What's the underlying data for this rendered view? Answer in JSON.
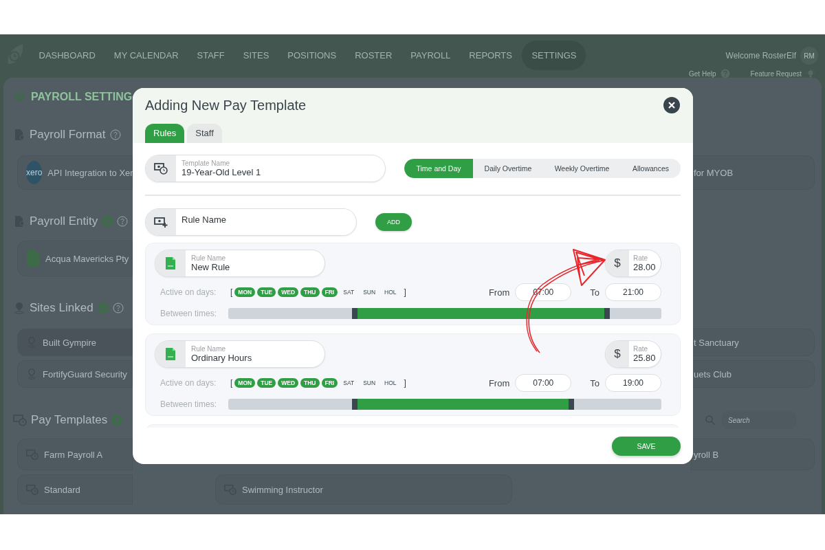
{
  "nav": {
    "items": [
      {
        "label": "DASHBOARD",
        "selected": false
      },
      {
        "label": "MY CALENDAR",
        "selected": false
      },
      {
        "label": "STAFF",
        "selected": false
      },
      {
        "label": "SITES",
        "selected": false
      },
      {
        "label": "POSITIONS",
        "selected": false
      },
      {
        "label": "ROSTER",
        "selected": false
      },
      {
        "label": "PAYROLL",
        "selected": false
      },
      {
        "label": "REPORTS",
        "selected": false
      },
      {
        "label": "SETTINGS",
        "selected": true
      }
    ],
    "welcome": "Welcome RosterElf",
    "avatar": "RM",
    "help": "Get Help",
    "feature": "Feature Request"
  },
  "background": {
    "title": "PAYROLL SETTING",
    "payroll_format": {
      "title": "Payroll Format",
      "items": [
        {
          "logo": "xero",
          "label": "API Integration to Xer"
        },
        {
          "label": "for MYOB"
        }
      ]
    },
    "payroll_entity": {
      "title": "Payroll Entity",
      "can_add": true,
      "items": [
        {
          "label": "Acqua Mavericks Pty"
        }
      ]
    },
    "sites_linked": {
      "title": "Sites Linked",
      "can_add": true,
      "items": [
        {
          "label": "Built Gympire"
        },
        {
          "label": "FortifyGuard Security"
        },
        {
          "label": "t Sanctuary"
        },
        {
          "label": "uets Club"
        }
      ]
    },
    "pay_templates": {
      "title": "Pay Templates",
      "can_add": true,
      "search_placeholder": "Search",
      "items": [
        {
          "label": "Farm Payroll A"
        },
        {
          "label": "yroll B"
        },
        {
          "label": "Standard"
        },
        {
          "label": "Swimming Instructor"
        }
      ]
    }
  },
  "modal": {
    "title": "Adding New Pay Template",
    "tabs": [
      {
        "label": "Rules",
        "selected": true
      },
      {
        "label": "Staff",
        "selected": false
      }
    ],
    "template_name": {
      "label": "Template Name",
      "value": "19-Year-Old Level 1"
    },
    "rule_types": [
      {
        "label": "Time and Day",
        "selected": true
      },
      {
        "label": "Daily Overtime",
        "selected": false
      },
      {
        "label": "Weekly Overtime",
        "selected": false
      },
      {
        "label": "Allowances",
        "selected": false
      }
    ],
    "new_rule": {
      "placeholder": "Rule Name",
      "button": "ADD"
    },
    "rules": [
      {
        "name_label": "Rule Name",
        "name": "New Rule",
        "rate_label": "Rate",
        "currency": "$",
        "rate": "28.00",
        "days_label": "Active on days:",
        "brackets": [
          "[",
          "]"
        ],
        "days": [
          {
            "label": "MON",
            "selected": true
          },
          {
            "label": "TUE",
            "selected": true
          },
          {
            "label": "WED",
            "selected": true
          },
          {
            "label": "THU",
            "selected": true
          },
          {
            "label": "FRI",
            "selected": true
          },
          {
            "label": "SAT",
            "selected": false
          },
          {
            "label": "SUN",
            "selected": false
          },
          {
            "label": "HOL",
            "selected": false
          }
        ],
        "from_label": "From",
        "from": "07:00",
        "to_label": "To",
        "to": "21:00",
        "times_label": "Between times:",
        "handles": [
          {
            "level": 0.292
          },
          {
            "level": 0.875
          }
        ]
      },
      {
        "name_label": "Rule Name",
        "name": "Ordinary Hours",
        "rate_label": "Rate",
        "currency": "$",
        "rate": "25.80",
        "days_label": "Active on days:",
        "brackets": [
          "[",
          "]"
        ],
        "days": [
          {
            "label": "MON",
            "selected": true
          },
          {
            "label": "TUE",
            "selected": true
          },
          {
            "label": "WED",
            "selected": true
          },
          {
            "label": "THU",
            "selected": true
          },
          {
            "label": "FRI",
            "selected": true
          },
          {
            "label": "SAT",
            "selected": false
          },
          {
            "label": "SUN",
            "selected": false
          },
          {
            "label": "HOL",
            "selected": false
          }
        ],
        "from_label": "From",
        "from": "07:00",
        "to_label": "To",
        "to": "19:00",
        "times_label": "Between times:",
        "handles": [
          {
            "level": 0.292
          },
          {
            "level": 0.792
          }
        ]
      }
    ],
    "save": "SAVE"
  }
}
